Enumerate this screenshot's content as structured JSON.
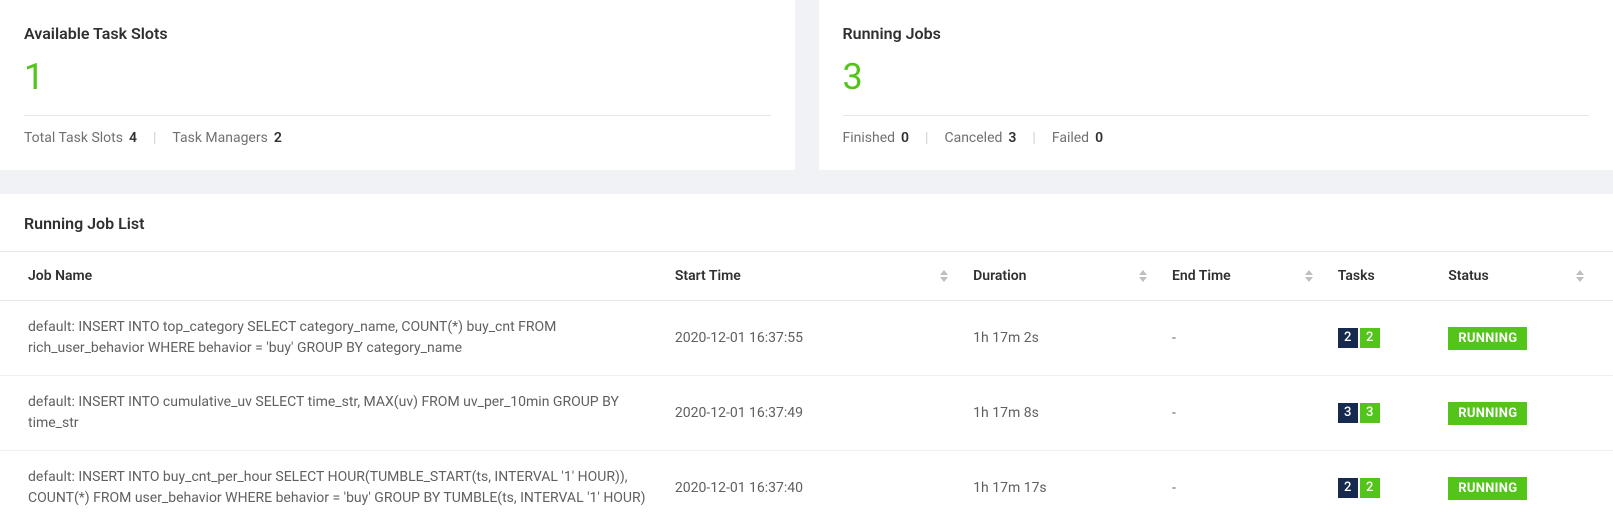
{
  "slots": {
    "title": "Available Task Slots",
    "available": "1",
    "totalLabel": "Total Task Slots",
    "totalValue": "4",
    "managersLabel": "Task Managers",
    "managersValue": "2"
  },
  "runningJobs": {
    "title": "Running Jobs",
    "count": "3",
    "finishedLabel": "Finished",
    "finishedValue": "0",
    "canceledLabel": "Canceled",
    "canceledValue": "3",
    "failedLabel": "Failed",
    "failedValue": "0"
  },
  "jobList": {
    "title": "Running Job List",
    "columns": {
      "jobName": "Job Name",
      "startTime": "Start Time",
      "duration": "Duration",
      "endTime": "End Time",
      "tasks": "Tasks",
      "status": "Status"
    },
    "rows": [
      {
        "jobName": "default: INSERT INTO top_category SELECT category_name, COUNT(*) buy_cnt FROM rich_user_behavior WHERE behavior = 'buy' GROUP BY category_name",
        "startTime": "2020-12-01 16:37:55",
        "duration": "1h 17m 2s",
        "endTime": "-",
        "tasksA": "2",
        "tasksB": "2",
        "status": "RUNNING"
      },
      {
        "jobName": "default: INSERT INTO cumulative_uv SELECT time_str, MAX(uv) FROM uv_per_10min GROUP BY time_str",
        "startTime": "2020-12-01 16:37:49",
        "duration": "1h 17m 8s",
        "endTime": "-",
        "tasksA": "3",
        "tasksB": "3",
        "status": "RUNNING"
      },
      {
        "jobName": "default: INSERT INTO buy_cnt_per_hour SELECT HOUR(TUMBLE_START(ts, INTERVAL '1' HOUR)), COUNT(*) FROM user_behavior WHERE behavior = 'buy' GROUP BY TUMBLE(ts, INTERVAL '1' HOUR)",
        "startTime": "2020-12-01 16:37:40",
        "duration": "1h 17m 17s",
        "endTime": "-",
        "tasksA": "2",
        "tasksB": "2",
        "status": "RUNNING"
      }
    ]
  }
}
